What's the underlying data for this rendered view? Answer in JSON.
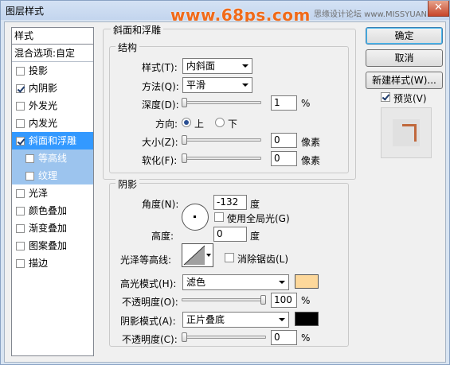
{
  "window": {
    "title": "图层样式",
    "close_glyph": "✕"
  },
  "watermark": {
    "main": "www.68ps.com",
    "right": "思缘设计论坛 www.MISSYUAN.com"
  },
  "styles_list": {
    "header": "样式",
    "blend_options": "混合选项:自定",
    "items": [
      {
        "label": "投影",
        "checked": false
      },
      {
        "label": "内阴影",
        "checked": true
      },
      {
        "label": "外发光",
        "checked": false
      },
      {
        "label": "内发光",
        "checked": false
      },
      {
        "label": "斜面和浮雕",
        "checked": true,
        "selected": true
      },
      {
        "label": "等高线",
        "checked": false,
        "sub": true
      },
      {
        "label": "纹理",
        "checked": false,
        "sub": true
      },
      {
        "label": "光泽",
        "checked": false
      },
      {
        "label": "颜色叠加",
        "checked": false
      },
      {
        "label": "渐变叠加",
        "checked": false
      },
      {
        "label": "图案叠加",
        "checked": false
      },
      {
        "label": "描边",
        "checked": false
      }
    ]
  },
  "bevel": {
    "section_title": "斜面和浮雕",
    "structure_title": "结构",
    "style_label": "样式(T):",
    "style_value": "内斜面",
    "technique_label": "方法(Q):",
    "technique_value": "平滑",
    "depth_label": "深度(D):",
    "depth_value": "1",
    "depth_unit": "%",
    "depth_fraction": 0.0,
    "direction_label": "方向:",
    "direction_up": "上",
    "direction_down": "下",
    "size_label": "大小(Z):",
    "size_value": "0",
    "size_unit": "像素",
    "size_fraction": 0.0,
    "soften_label": "软化(F):",
    "soften_value": "0",
    "soften_unit": "像素",
    "soften_fraction": 0.0
  },
  "shading": {
    "title": "阴影",
    "angle_label": "角度(N):",
    "angle_value": "-132",
    "angle_unit": "度",
    "global_light_label": "使用全局光(G)",
    "altitude_label": "高度:",
    "altitude_value": "0",
    "altitude_unit": "度",
    "gloss_contour_label": "光泽等高线:",
    "anti_aliased_label": "消除锯齿(L)",
    "highlight_mode_label": "高光模式(H):",
    "highlight_mode_value": "滤色",
    "highlight_color": "#fdd89b",
    "highlight_opacity_label": "不透明度(O):",
    "highlight_opacity_value": "100",
    "highlight_opacity_unit": "%",
    "highlight_opacity_fraction": 1.0,
    "shadow_mode_label": "阴影模式(A):",
    "shadow_mode_value": "正片叠底",
    "shadow_color": "#000000",
    "shadow_opacity_label": "不透明度(C):",
    "shadow_opacity_value": "0",
    "shadow_opacity_unit": "%",
    "shadow_opacity_fraction": 0.0
  },
  "buttons": {
    "ok": "确定",
    "cancel": "取消",
    "new_style": "新建样式(W)...",
    "preview_label": "预览(V)",
    "preview_checked": true
  },
  "colors": {
    "preview_stroke": "#c0683c",
    "accent": "#3399ff"
  }
}
